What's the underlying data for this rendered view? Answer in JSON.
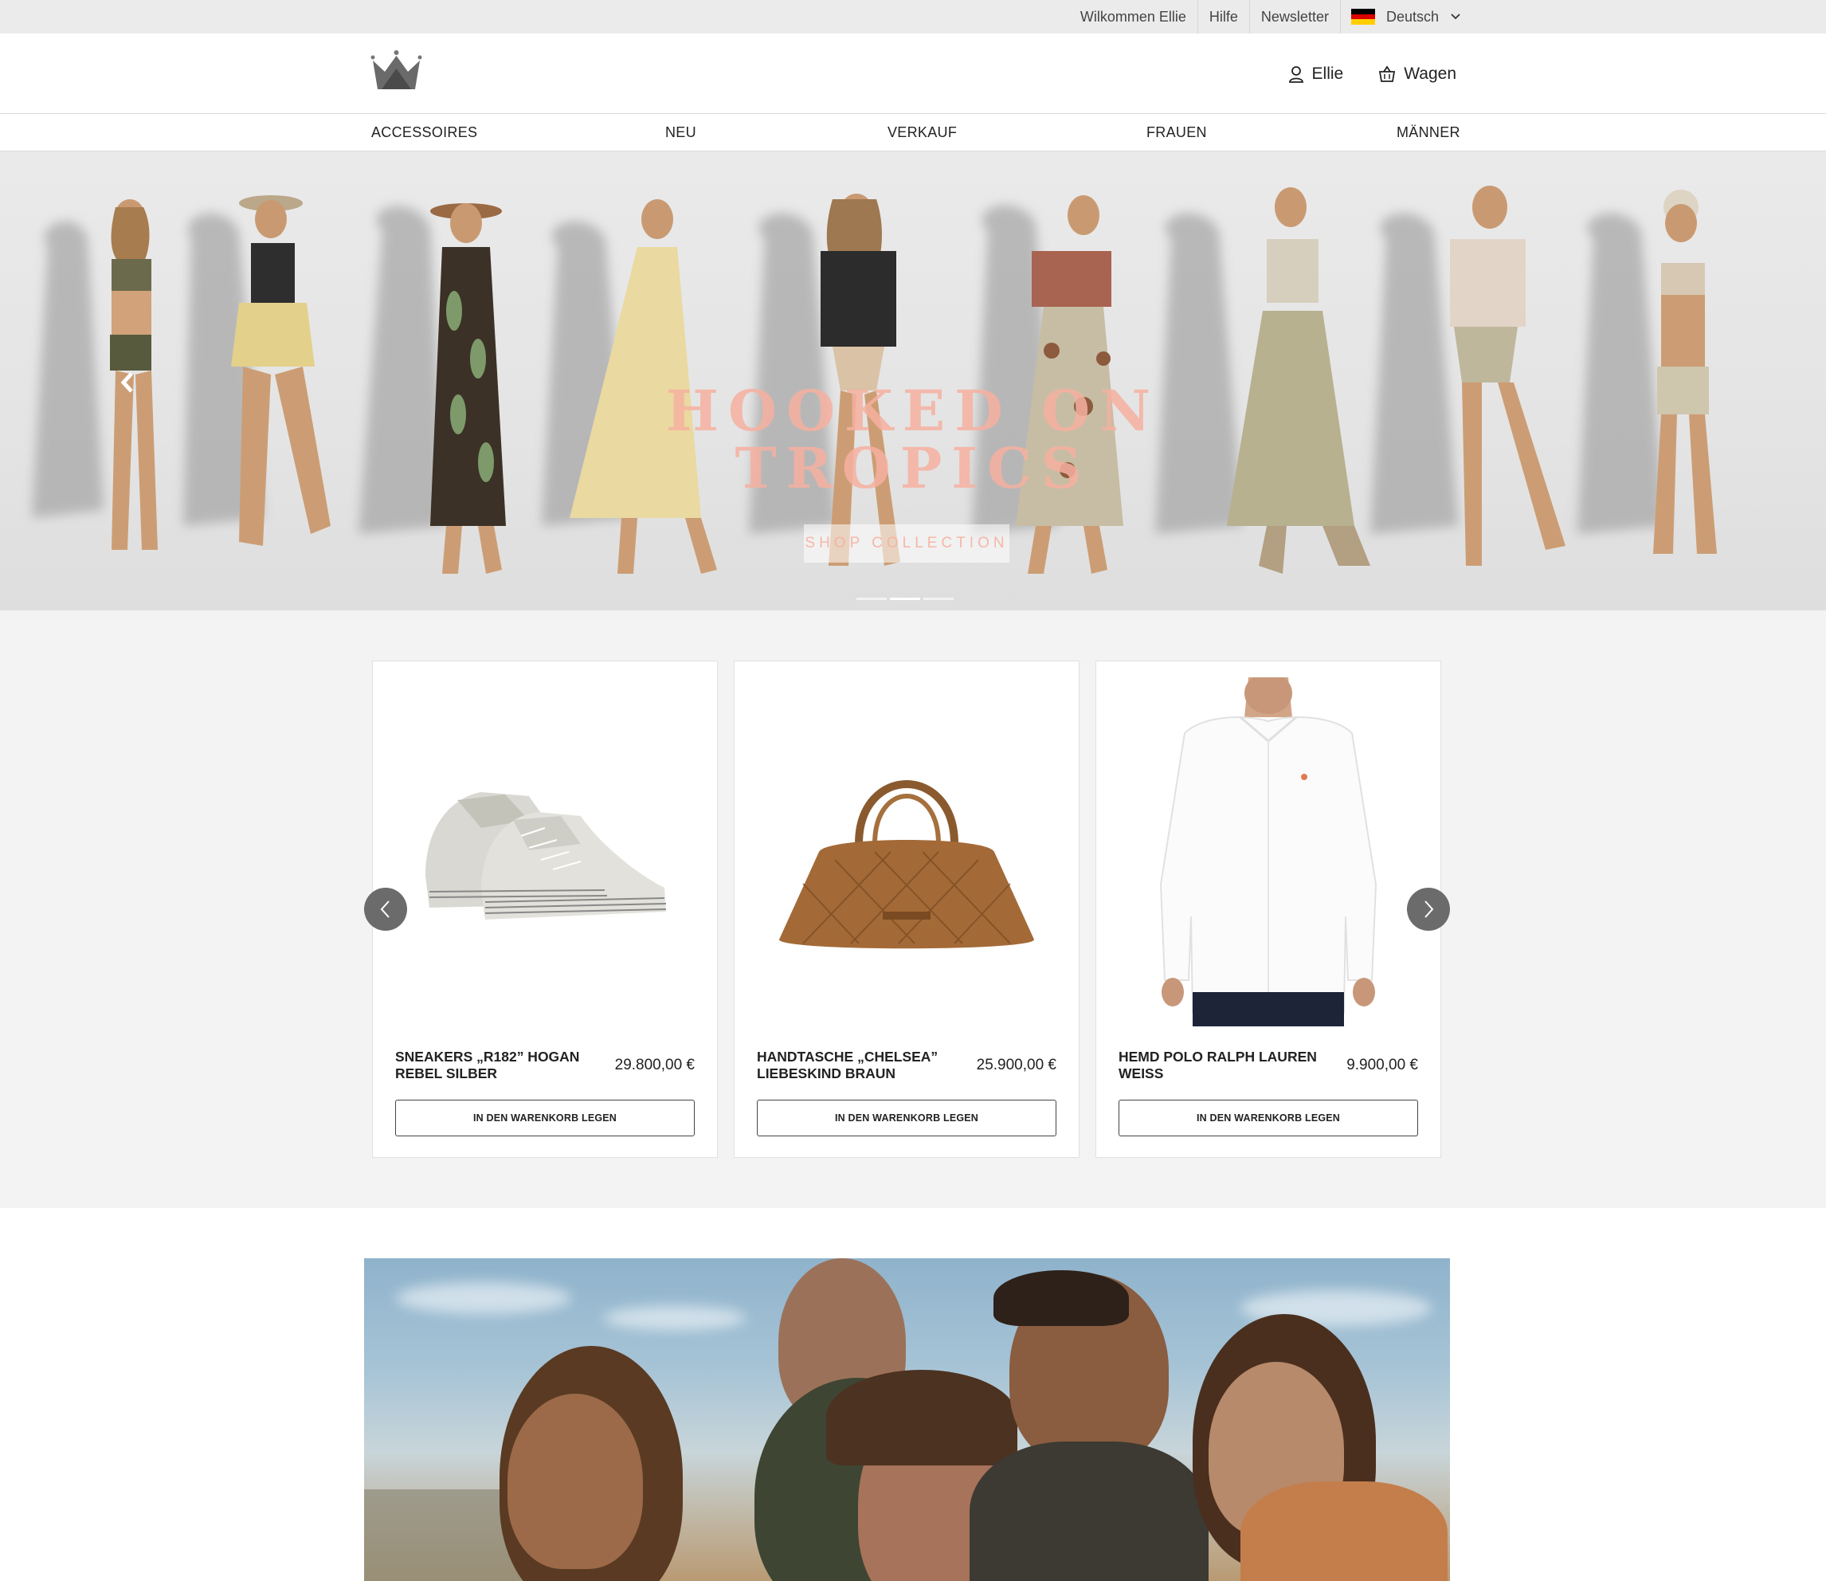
{
  "topbar": {
    "welcome": "Wilkommen Ellie",
    "help": "Hilfe",
    "newsletter": "Newsletter",
    "language": "Deutsch",
    "flag_colors": [
      "#000000",
      "#dd0000",
      "#ffce00"
    ]
  },
  "header": {
    "logo_icon": "crown-icon",
    "account_label": "Ellie",
    "cart_label": "Wagen"
  },
  "nav": {
    "items": [
      "ACCESSOIRES",
      "NEU",
      "VERKAUF",
      "FRAUEN",
      "MÄNNER"
    ]
  },
  "hero": {
    "title_line1": "HOOKED ON",
    "title_line2": "TROPICS",
    "button_label": "SHOP COLLECTION",
    "slide_count": 3,
    "active_slide": 2,
    "accent_color": "#f6b0a0"
  },
  "products": [
    {
      "name": "SNEAKERS „R182” HOGAN REBEL SILBER",
      "price": "29.800,00 €",
      "button": "IN DEN WARENKORB LEGEN",
      "image": "silver-sneakers"
    },
    {
      "name": "HANDTASCHE „CHELSEA” LIEBESKIND BRAUN",
      "price": "25.900,00 €",
      "button": "IN DEN WARENKORB LEGEN",
      "image": "brown-handbag"
    },
    {
      "name": "HEMD POLO RALPH LAUREN WEISS",
      "price": "9.900,00 €",
      "button": "IN DEN WARENKORB LEGEN",
      "image": "white-shirt"
    }
  ]
}
